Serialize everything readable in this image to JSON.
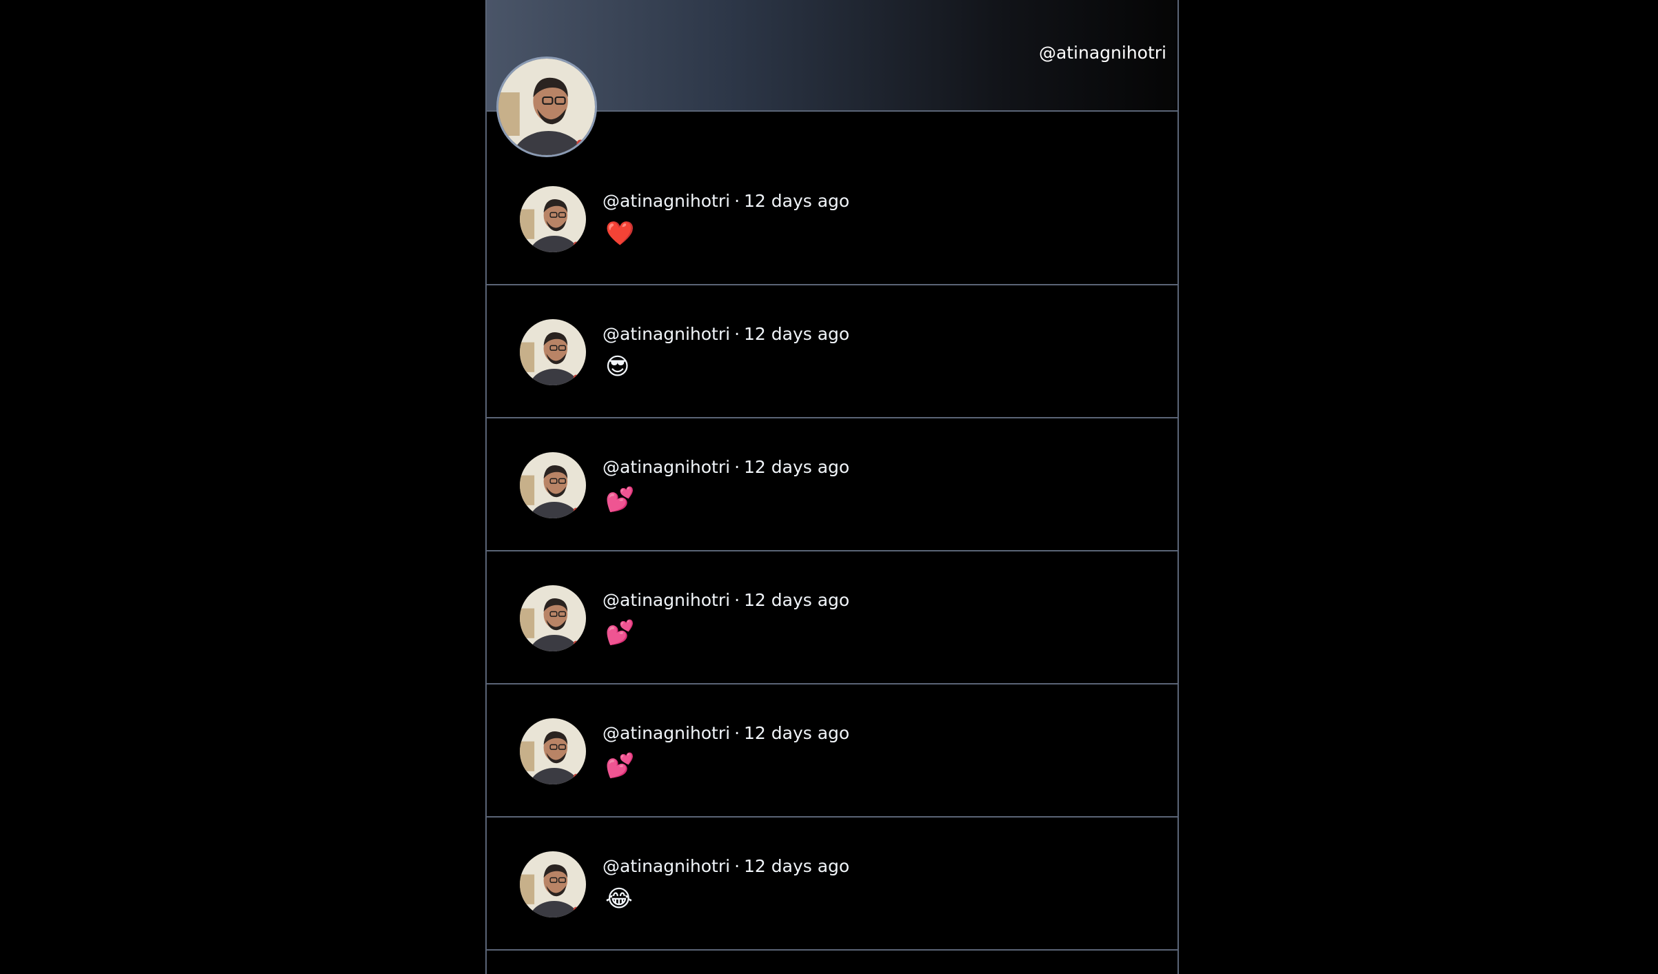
{
  "profile": {
    "handle": "@atinagnihotri"
  },
  "posts": [
    {
      "author": "@atinagnihotri",
      "time": "12 days ago",
      "content": "❤️"
    },
    {
      "author": "@atinagnihotri",
      "time": "12 days ago",
      "content": "😎"
    },
    {
      "author": "@atinagnihotri",
      "time": "12 days ago",
      "content": "💕"
    },
    {
      "author": "@atinagnihotri",
      "time": "12 days ago",
      "content": "💕"
    },
    {
      "author": "@atinagnihotri",
      "time": "12 days ago",
      "content": "💕"
    },
    {
      "author": "@atinagnihotri",
      "time": "12 days ago",
      "content": "😂"
    }
  ],
  "meta_separator": "·",
  "colors": {
    "background": "#000000",
    "border": "#5b6577",
    "text": "#f1f5f9",
    "banner_gradient_start": "#4a5568"
  }
}
